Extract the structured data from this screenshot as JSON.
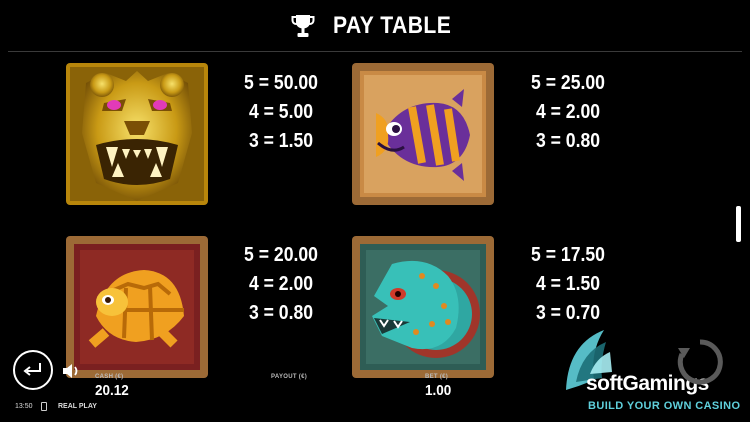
{
  "header": {
    "title": "PAY TABLE",
    "icon": "trophy-icon"
  },
  "symbols": [
    {
      "name": "golden-jaguar",
      "pays": [
        "5 = 50.00",
        "4 = 5.00",
        "3 = 1.50"
      ]
    },
    {
      "name": "purple-fish",
      "pays": [
        "5 = 25.00",
        "4 = 2.00",
        "3 = 0.80"
      ]
    },
    {
      "name": "orange-turtle",
      "pays": [
        "5 = 20.00",
        "4 = 2.00",
        "3 = 0.80"
      ]
    },
    {
      "name": "teal-serpent",
      "pays": [
        "5 = 17.50",
        "4 = 1.50",
        "3 = 0.70"
      ]
    }
  ],
  "bottom_bar": {
    "cash_label": "CASH (€)",
    "cash_value": "20.12",
    "payout_label": "PAYOUT (€)",
    "bet_label": "BET (€)",
    "bet_value": "1.00",
    "clock": "13:50",
    "mode": "REAL PLAY"
  },
  "brand": {
    "name": "softGamings",
    "tagline": "BUILD YOUR OWN CASINO",
    "accent_color": "#5fd0dc"
  }
}
